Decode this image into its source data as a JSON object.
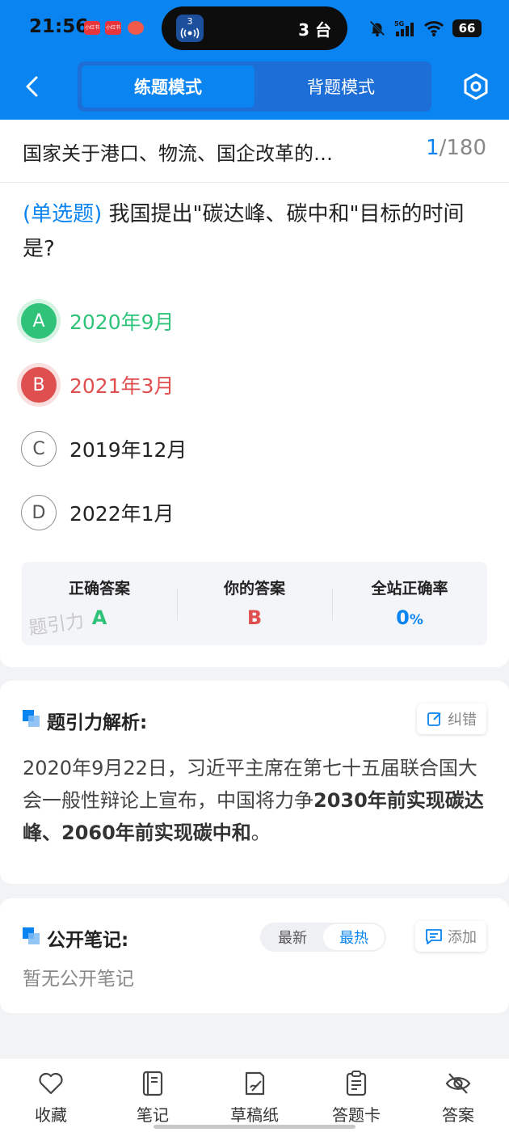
{
  "statusbar": {
    "time": "21:56",
    "island_badge": "3",
    "island_text": "3 台",
    "network": "5G",
    "battery": "66"
  },
  "nav": {
    "modes": [
      "练题模式",
      "背题模式"
    ],
    "active_mode": "练题模式"
  },
  "chapter": {
    "title": "国家关于港口、物流、国企改革的…",
    "current": "1",
    "total": "/180"
  },
  "question": {
    "type": "(单选题)",
    "text": " 我国提出\"碳达峰、碳中和\"目标的时间是?",
    "options": [
      {
        "letter": "A",
        "text": "2020年9月",
        "state": "correct"
      },
      {
        "letter": "B",
        "text": "2021年3月",
        "state": "wrong"
      },
      {
        "letter": "C",
        "text": "2019年12月",
        "state": "normal"
      },
      {
        "letter": "D",
        "text": "2022年1月",
        "state": "normal"
      }
    ]
  },
  "answer_summary": {
    "correct_label": "正确答案",
    "correct_value": "A",
    "yours_label": "你的答案",
    "yours_value": "B",
    "rate_label": "全站正确率",
    "rate_value": "0",
    "rate_unit": "%",
    "watermark": "题引力"
  },
  "analysis": {
    "title": "题引力解析:",
    "report_label": "纠错",
    "text_plain": "2020年9月22日，习近平主席在第七十五届联合国大会一般性辩论上宣布，中国将力争",
    "text_bold": "2030年前实现碳达峰、2060年前实现碳中和",
    "text_end": "。"
  },
  "notes": {
    "title": "公开笔记:",
    "sort_options": [
      "最新",
      "最热"
    ],
    "active_sort": "最热",
    "add_label": "添加",
    "empty_text": "暂无公开笔记"
  },
  "bottom_nav": [
    {
      "label": "收藏",
      "icon": "heart-icon"
    },
    {
      "label": "笔记",
      "icon": "notebook-icon"
    },
    {
      "label": "草稿纸",
      "icon": "draft-icon"
    },
    {
      "label": "答题卡",
      "icon": "answer-card-icon"
    },
    {
      "label": "答案",
      "icon": "eye-off-icon"
    }
  ],
  "colors": {
    "primary": "#0a84f0",
    "correct": "#2fc37a",
    "wrong": "#e04f4f"
  }
}
